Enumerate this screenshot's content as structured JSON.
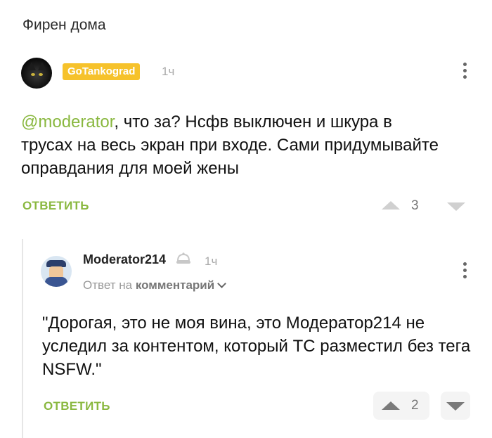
{
  "post": {
    "title": "Фирен дома"
  },
  "comment1": {
    "author": "GoTankograd",
    "time": "1ч",
    "mention": "@moderator",
    "text": ", что за? Нсфв выключен и шкура в трусах на весь экран при входе. Сами придумывайте оправдания для моей жены",
    "reply_label": "ОТВЕТИТЬ",
    "score": "3"
  },
  "comment2": {
    "author": "Moderator214",
    "time": "1ч",
    "reply_to_prefix": "Ответ на",
    "reply_to_target": "комментарий",
    "text": "\"Дорогая, это не моя вина, это Модератор214 не уследил за контентом, который ТС разместил без тега NSFW.\"",
    "reply_label": "ОТВЕТИТЬ",
    "score": "2"
  },
  "colors": {
    "accent": "#8ab840",
    "badge": "#f6c22b"
  },
  "icons": [
    "black-cat-avatar",
    "moderator-avatar",
    "helmet-icon",
    "chevron-down-icon",
    "more-vertical-icon",
    "arrow-up-icon",
    "arrow-down-icon"
  ]
}
